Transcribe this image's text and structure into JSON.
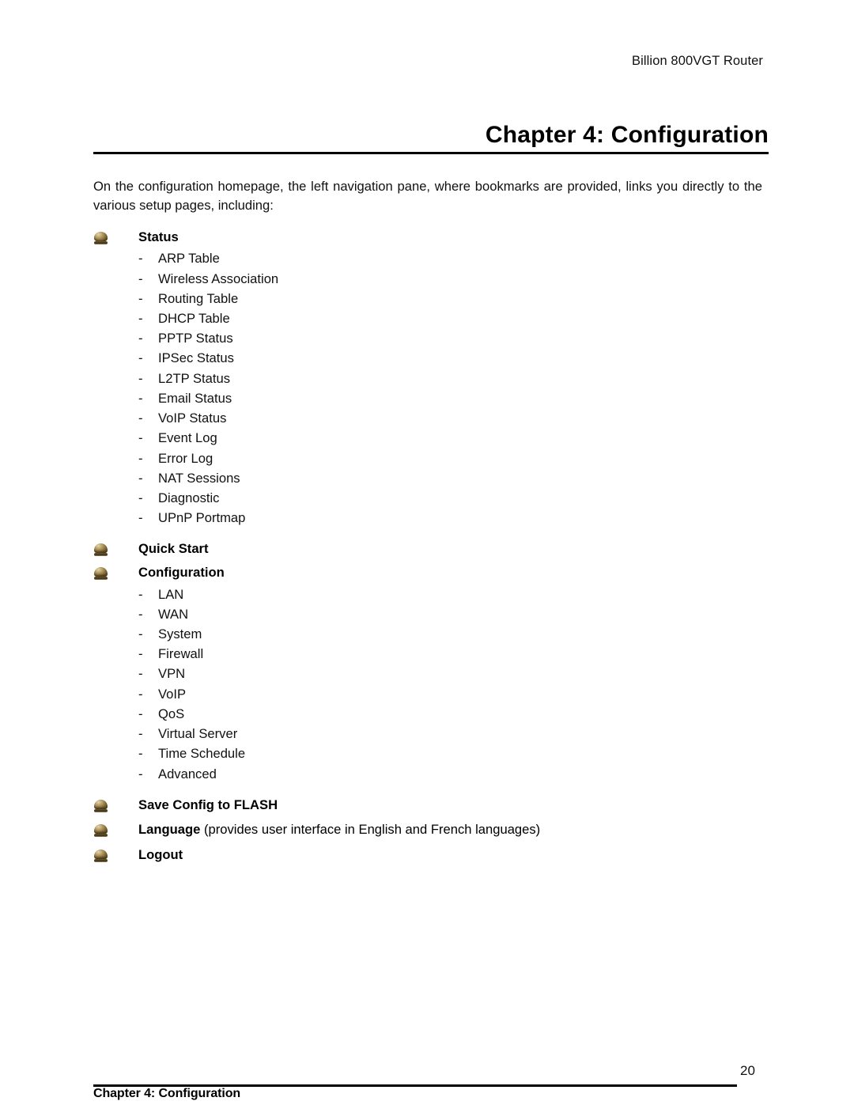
{
  "page": {
    "running_header": "Billion 800VGT Router",
    "title": "Chapter 4: Configuration",
    "intro": "On the configuration homepage, the left navigation pane, where bookmarks are provided, links you directly to the various setup pages, including:",
    "footer_title": "Chapter 4: Configuration",
    "page_number": "20"
  },
  "bookmarks": [
    {
      "label": "Status",
      "icon": "bookmark-bullet-icon",
      "items": [
        "ARP Table",
        "Wireless Association",
        "Routing Table",
        "DHCP Table",
        "PPTP Status",
        "IPSec Status",
        "L2TP Status",
        "Email Status",
        "VoIP Status",
        "Event Log",
        "Error Log",
        "NAT Sessions",
        "Diagnostic",
        "UPnP Portmap"
      ]
    },
    {
      "label": "Quick Start",
      "icon": "bookmark-bullet-icon",
      "items": []
    },
    {
      "label": "Configuration",
      "icon": "bookmark-bullet-icon",
      "items": [
        "LAN",
        "WAN",
        "System",
        "Firewall",
        "VPN",
        "VoIP",
        "QoS",
        "Virtual Server",
        "Time Schedule",
        "Advanced"
      ]
    },
    {
      "label": "Save Config to FLASH",
      "icon": "bookmark-bullet-icon",
      "items": []
    },
    {
      "label": "Language",
      "suffix": " (provides user interface in English and French languages)",
      "icon": "bookmark-bullet-icon",
      "items": []
    },
    {
      "label": "Logout",
      "icon": "bookmark-bullet-icon",
      "items": []
    }
  ],
  "list_marker": "-",
  "colors": {
    "text": "#111111",
    "rule": "#000000",
    "icon_highlight": "#e4d6ae",
    "icon_mid": "#b49b63",
    "icon_shadow": "#4e3f20"
  }
}
